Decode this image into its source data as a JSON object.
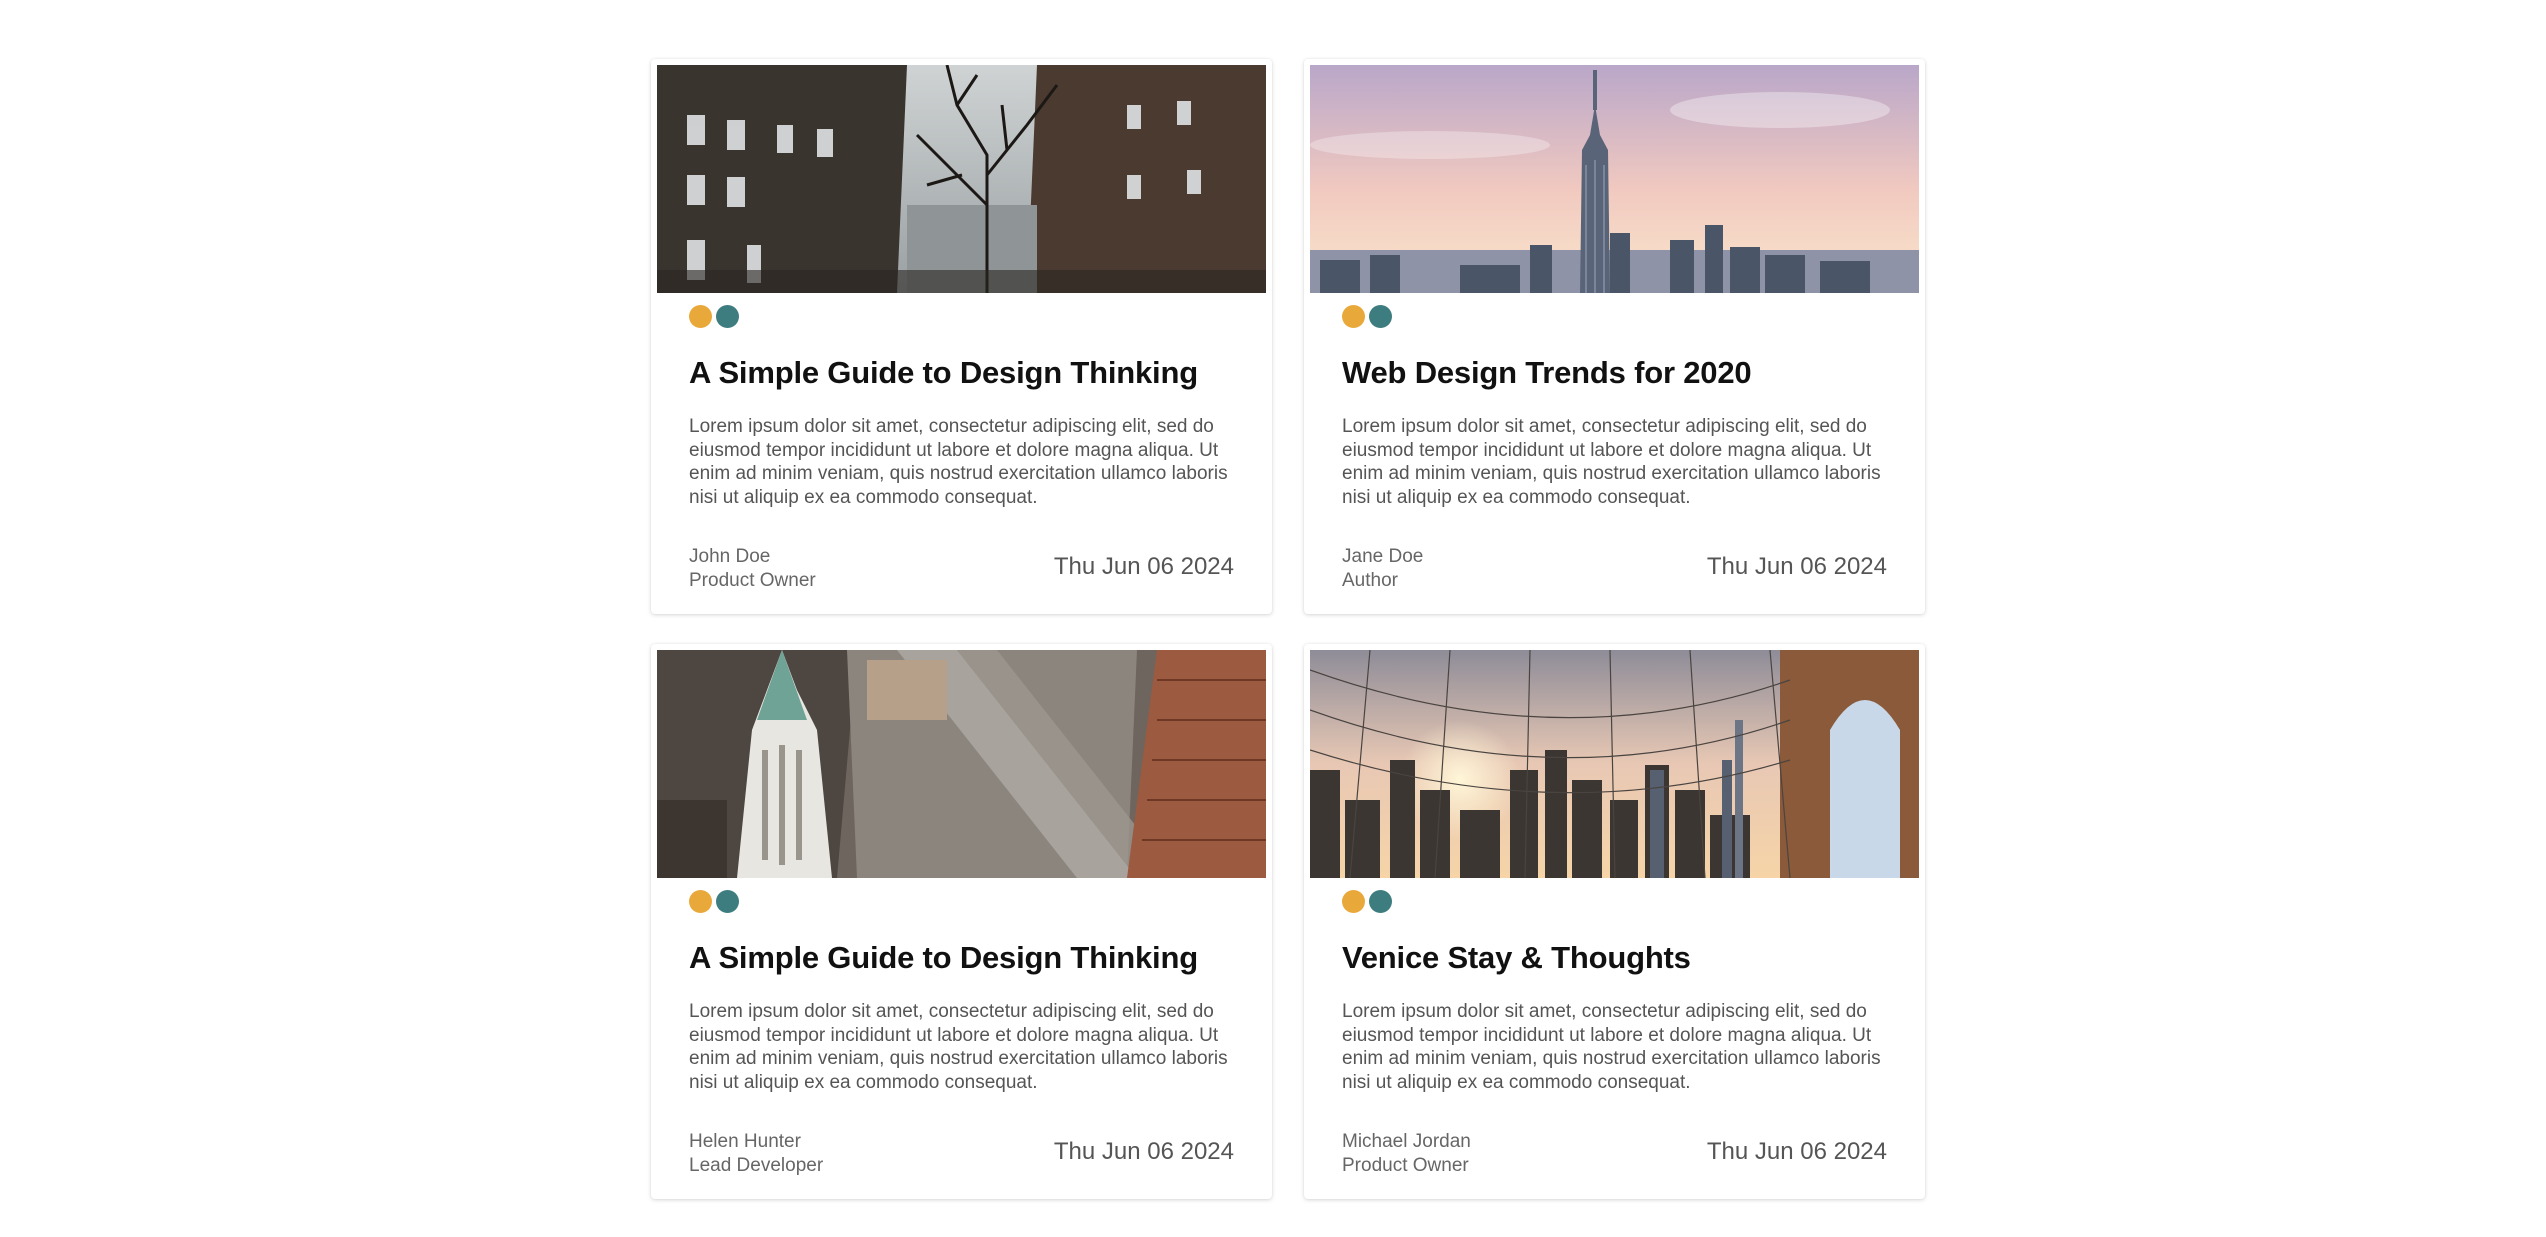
{
  "colors": {
    "dot_primary": "#E9A93A",
    "dot_secondary": "#3E7D7F"
  },
  "cards": [
    {
      "image": "snowy-street-photo",
      "title": "A Simple Guide to Design Thinking",
      "excerpt": "Lorem ipsum dolor sit amet, consectetur adipiscing elit, sed do eiusmod tempor incididunt ut labore et dolore magna aliqua. Ut enim ad minim veniam, quis nostrud exercitation ullamco laboris nisi ut aliquip ex ea commodo consequat.",
      "author_name": "John Doe",
      "author_role": "Product Owner",
      "date": "Thu Jun 06 2024"
    },
    {
      "image": "skyline-sunset-photo",
      "title": "Web Design Trends for 2020",
      "excerpt": "Lorem ipsum dolor sit amet, consectetur adipiscing elit, sed do eiusmod tempor incididunt ut labore et dolore magna aliqua. Ut enim ad minim veniam, quis nostrud exercitation ullamco laboris nisi ut aliquip ex ea commodo consequat.",
      "author_name": "Jane Doe",
      "author_role": "Author",
      "date": "Thu Jun 06 2024"
    },
    {
      "image": "aerial-city-photo",
      "title": "A Simple Guide to Design Thinking",
      "excerpt": "Lorem ipsum dolor sit amet, consectetur adipiscing elit, sed do eiusmod tempor incididunt ut labore et dolore magna aliqua. Ut enim ad minim veniam, quis nostrud exercitation ullamco laboris nisi ut aliquip ex ea commodo consequat.",
      "author_name": "Helen Hunter",
      "author_role": "Lead Developer",
      "date": "Thu Jun 06 2024"
    },
    {
      "image": "bridge-skyline-photo",
      "title": "Venice Stay & Thoughts",
      "excerpt": "Lorem ipsum dolor sit amet, consectetur adipiscing elit, sed do eiusmod tempor incididunt ut labore et dolore magna aliqua. Ut enim ad minim veniam, quis nostrud exercitation ullamco laboris nisi ut aliquip ex ea commodo consequat.",
      "author_name": "Michael Jordan",
      "author_role": "Product Owner",
      "date": "Thu Jun 06 2024"
    }
  ]
}
